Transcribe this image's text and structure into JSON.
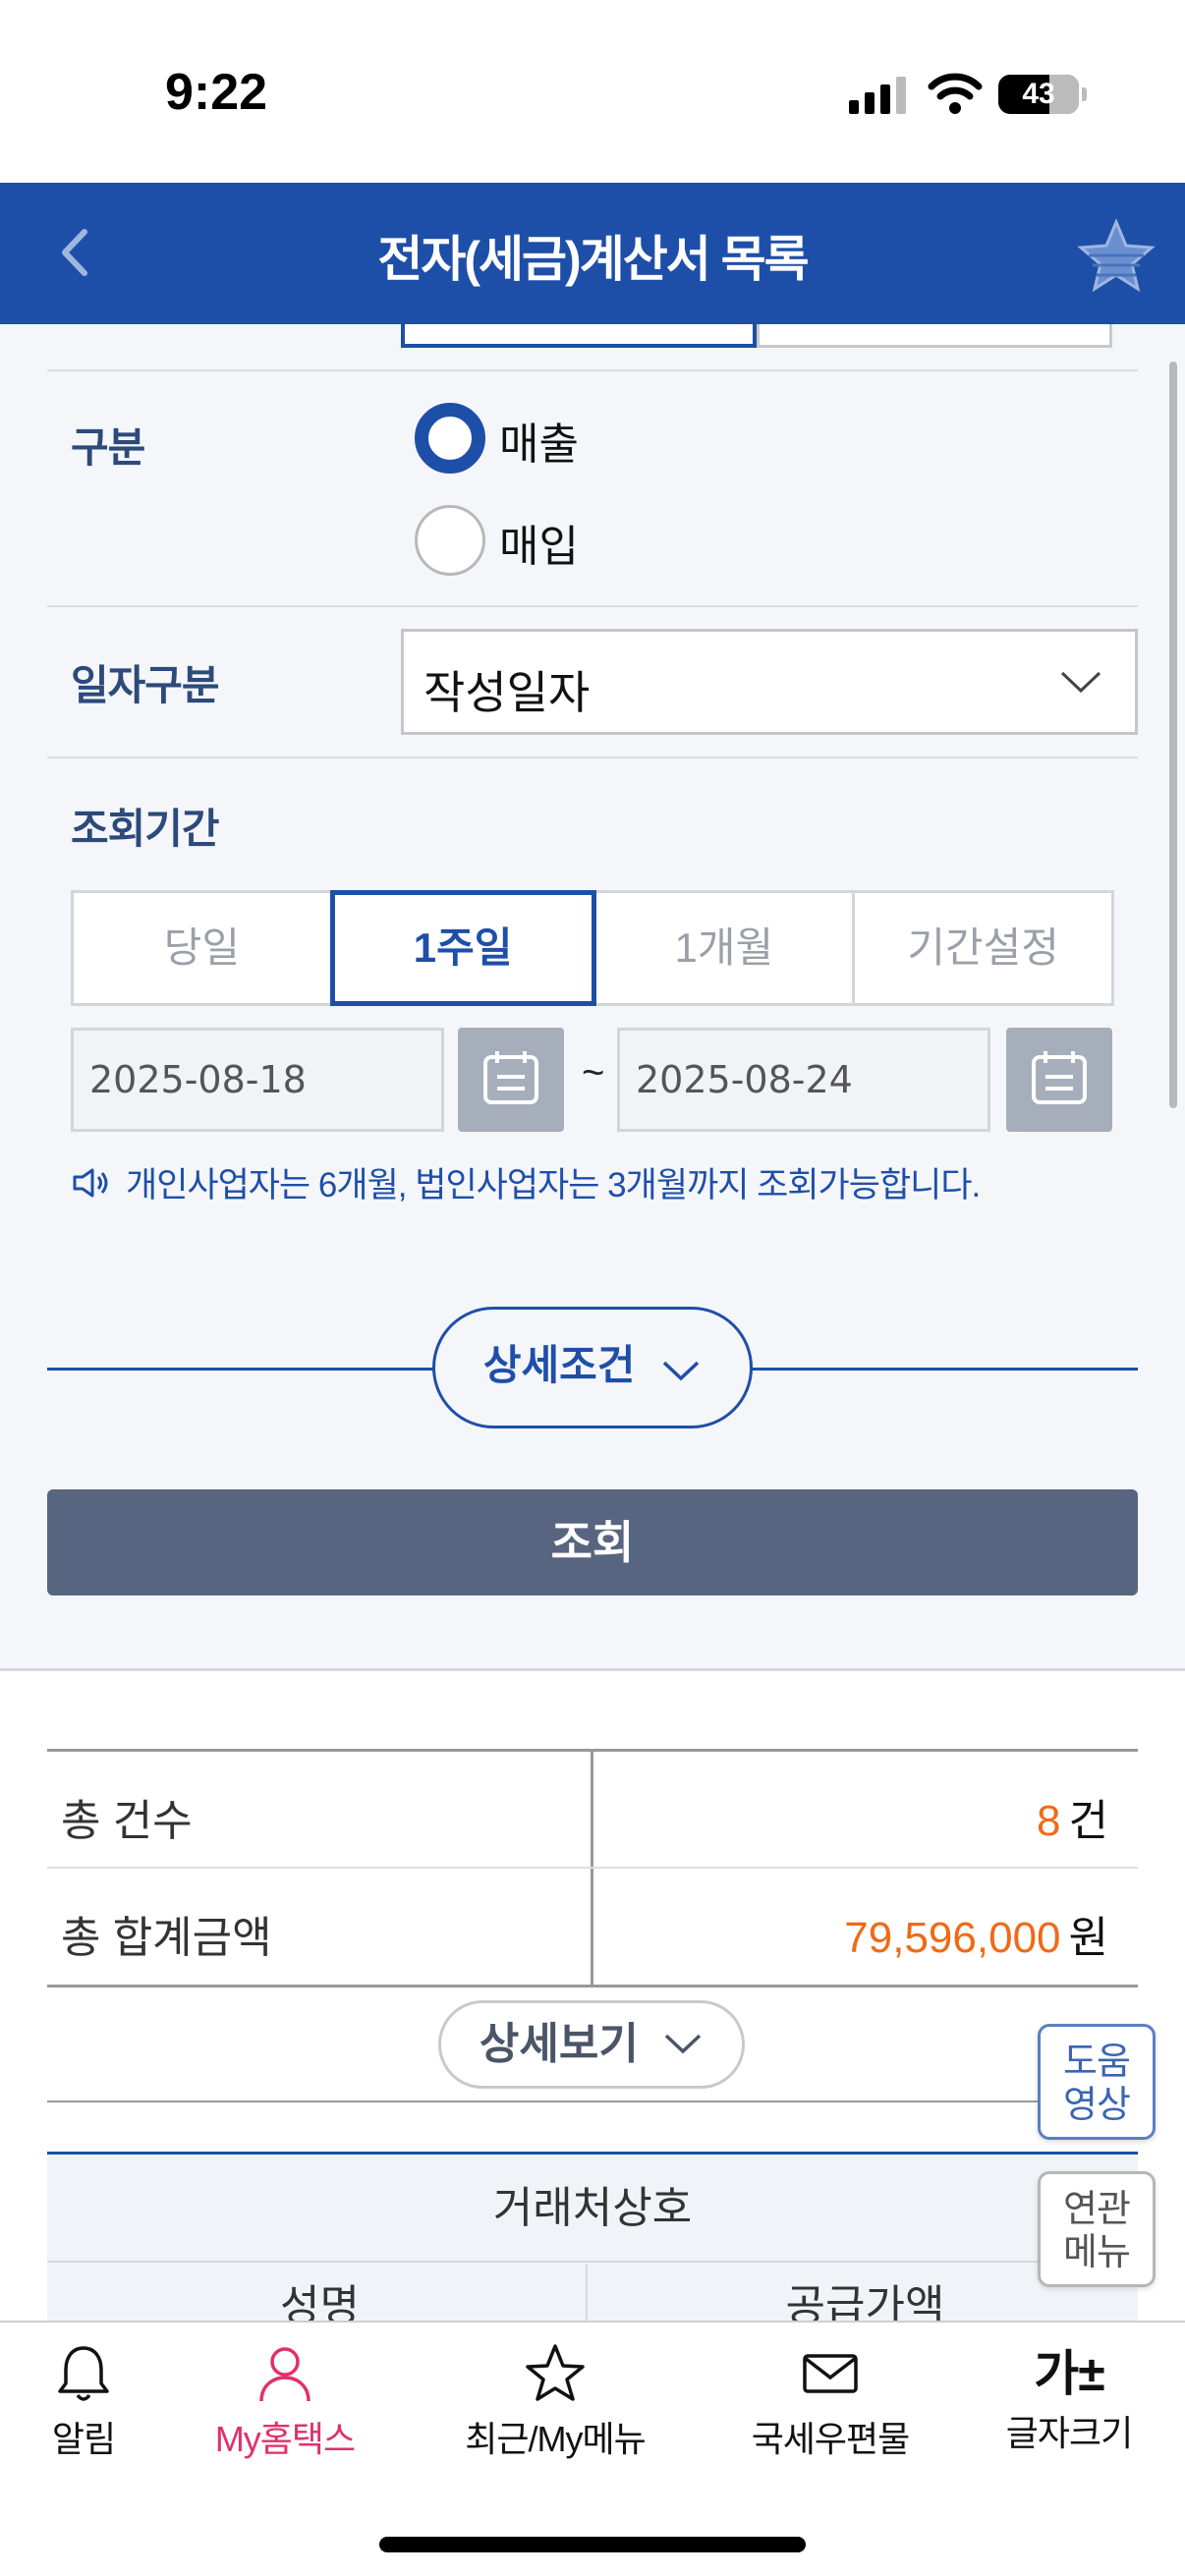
{
  "status_bar": {
    "time": "9:22",
    "battery": "43"
  },
  "header": {
    "title": "전자(세금)계산서 목록"
  },
  "form": {
    "type_label": "구분",
    "type_options": [
      {
        "label": "매출",
        "selected": true
      },
      {
        "label": "매입",
        "selected": false
      }
    ],
    "date_type_label": "일자구분",
    "date_type_value": "작성일자",
    "period_label": "조회기간",
    "period_tabs": [
      {
        "label": "당일",
        "active": false
      },
      {
        "label": "1주일",
        "active": true
      },
      {
        "label": "1개월",
        "active": false
      },
      {
        "label": "기간설정",
        "active": false
      }
    ],
    "start_date": "2025-08-18",
    "end_date": "2025-08-24",
    "range_separator": "~",
    "notice": "개인사업자는 6개월, 법인사업자는 3개월까지 조회가능합니다.",
    "detail_conditions_label": "상세조건",
    "search_button": "조회"
  },
  "summary": {
    "total_count_label": "총 건수",
    "total_count_value": "8",
    "total_count_unit": "건",
    "total_amount_label": "총 합계금액",
    "total_amount_value": "79,596,000",
    "total_amount_unit": "원",
    "detail_view_label": "상세보기"
  },
  "list_header": {
    "col_partner": "거래처상호",
    "col_item": "성명",
    "col_supply": "공급가액"
  },
  "floating": {
    "help_video": "도움\n영상",
    "related_menu": "연관\n메뉴"
  },
  "bottom_nav": [
    {
      "label": "알림",
      "icon": "bell-icon",
      "active": false
    },
    {
      "label": "My홈택스",
      "icon": "person-icon",
      "active": true
    },
    {
      "label": "최근/My메뉴",
      "icon": "star-icon",
      "active": false
    },
    {
      "label": "국세우편물",
      "icon": "mail-icon",
      "active": false
    },
    {
      "label": "글자크기",
      "icon": "font-size-icon",
      "glyph": "가±",
      "active": false
    }
  ],
  "colors": {
    "brand": "#1e4fa8",
    "accent_number": "#f06a16",
    "search_button": "#586580",
    "nav_active": "#e0306c"
  }
}
